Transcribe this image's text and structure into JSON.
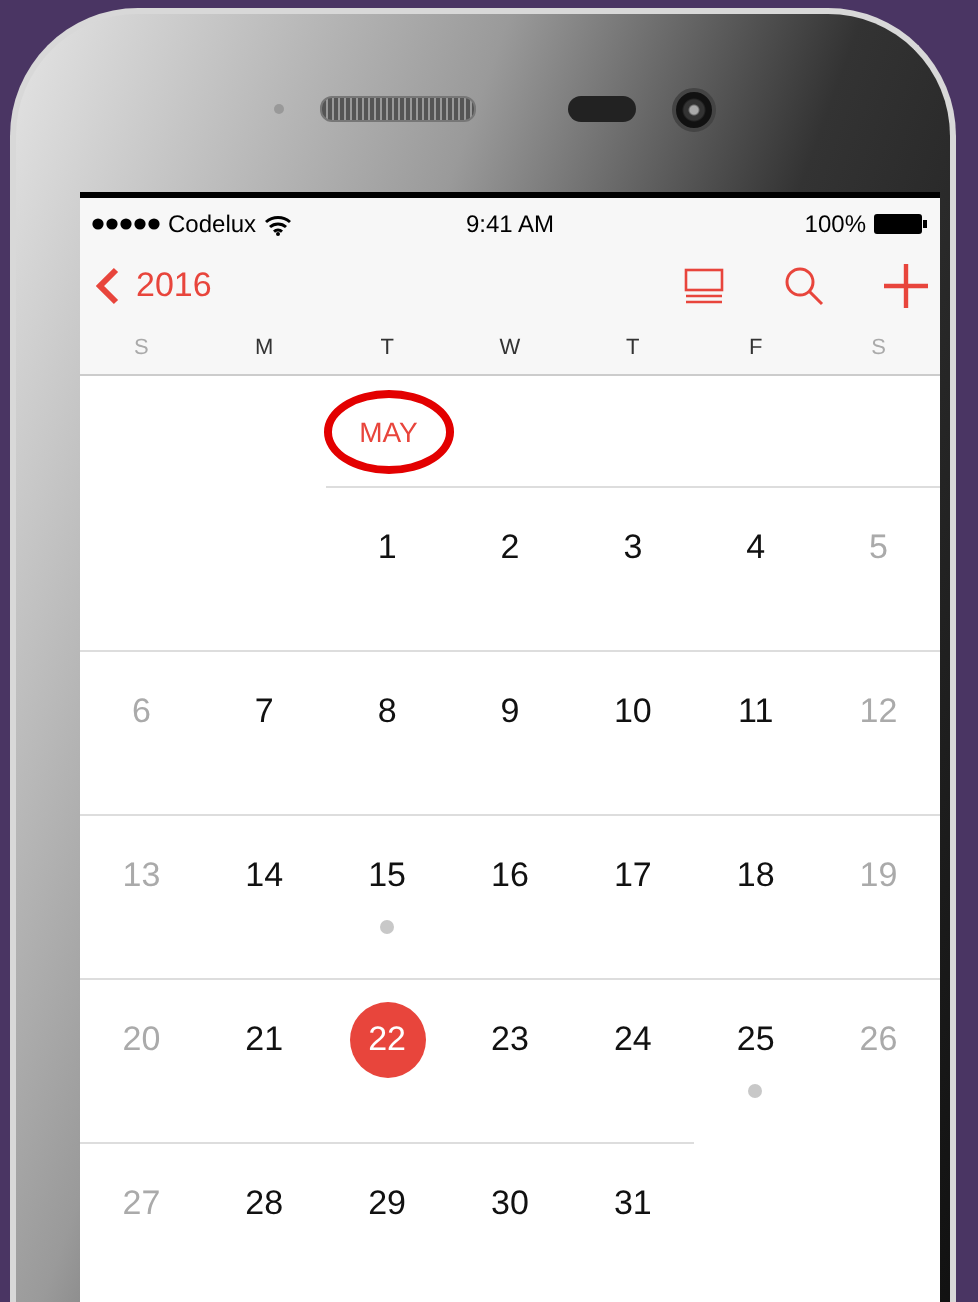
{
  "status_bar": {
    "carrier": "Codelux",
    "time": "9:41 AM",
    "battery": "100%"
  },
  "nav": {
    "back_label": "2016"
  },
  "weekdays": [
    {
      "label": "S",
      "weekend": true
    },
    {
      "label": "M",
      "weekend": false
    },
    {
      "label": "T",
      "weekend": false
    },
    {
      "label": "W",
      "weekend": false
    },
    {
      "label": "T",
      "weekend": false
    },
    {
      "label": "F",
      "weekend": false
    },
    {
      "label": "S",
      "weekend": true
    }
  ],
  "month": {
    "label": "MAY",
    "circled": true
  },
  "weeks": [
    {
      "days": [
        {
          "kind": "blank"
        },
        {
          "kind": "blank"
        },
        {
          "kind": "day",
          "label": "1",
          "weekend": false,
          "selected": false,
          "event": false
        },
        {
          "kind": "day",
          "label": "2",
          "weekend": false,
          "selected": false,
          "event": false
        },
        {
          "kind": "day",
          "label": "3",
          "weekend": false,
          "selected": false,
          "event": false
        },
        {
          "kind": "day",
          "label": "4",
          "weekend": false,
          "selected": false,
          "event": false
        },
        {
          "kind": "day",
          "label": "5",
          "weekend": true,
          "selected": false,
          "event": false
        }
      ]
    },
    {
      "days": [
        {
          "kind": "day",
          "label": "6",
          "weekend": true,
          "selected": false,
          "event": false
        },
        {
          "kind": "day",
          "label": "7",
          "weekend": false,
          "selected": false,
          "event": false
        },
        {
          "kind": "day",
          "label": "8",
          "weekend": false,
          "selected": false,
          "event": false
        },
        {
          "kind": "day",
          "label": "9",
          "weekend": false,
          "selected": false,
          "event": false
        },
        {
          "kind": "day",
          "label": "10",
          "weekend": false,
          "selected": false,
          "event": false
        },
        {
          "kind": "day",
          "label": "11",
          "weekend": false,
          "selected": false,
          "event": false
        },
        {
          "kind": "day",
          "label": "12",
          "weekend": true,
          "selected": false,
          "event": false
        }
      ]
    },
    {
      "days": [
        {
          "kind": "day",
          "label": "13",
          "weekend": true,
          "selected": false,
          "event": false
        },
        {
          "kind": "day",
          "label": "14",
          "weekend": false,
          "selected": false,
          "event": false
        },
        {
          "kind": "day",
          "label": "15",
          "weekend": false,
          "selected": false,
          "event": true
        },
        {
          "kind": "day",
          "label": "16",
          "weekend": false,
          "selected": false,
          "event": false
        },
        {
          "kind": "day",
          "label": "17",
          "weekend": false,
          "selected": false,
          "event": false
        },
        {
          "kind": "day",
          "label": "18",
          "weekend": false,
          "selected": false,
          "event": false
        },
        {
          "kind": "day",
          "label": "19",
          "weekend": true,
          "selected": false,
          "event": false
        }
      ]
    },
    {
      "days": [
        {
          "kind": "day",
          "label": "20",
          "weekend": true,
          "selected": false,
          "event": false
        },
        {
          "kind": "day",
          "label": "21",
          "weekend": false,
          "selected": false,
          "event": false
        },
        {
          "kind": "day",
          "label": "22",
          "weekend": false,
          "selected": true,
          "event": false
        },
        {
          "kind": "day",
          "label": "23",
          "weekend": false,
          "selected": false,
          "event": false
        },
        {
          "kind": "day",
          "label": "24",
          "weekend": false,
          "selected": false,
          "event": false
        },
        {
          "kind": "day",
          "label": "25",
          "weekend": false,
          "selected": false,
          "event": true
        },
        {
          "kind": "day",
          "label": "26",
          "weekend": true,
          "selected": false,
          "event": false
        }
      ]
    },
    {
      "days": [
        {
          "kind": "day",
          "label": "27",
          "weekend": true,
          "selected": false,
          "event": false
        },
        {
          "kind": "day",
          "label": "28",
          "weekend": false,
          "selected": false,
          "event": false
        },
        {
          "kind": "day",
          "label": "29",
          "weekend": false,
          "selected": false,
          "event": false
        },
        {
          "kind": "day",
          "label": "30",
          "weekend": false,
          "selected": false,
          "event": false
        },
        {
          "kind": "day",
          "label": "31",
          "weekend": false,
          "selected": false,
          "event": false
        }
      ]
    }
  ]
}
